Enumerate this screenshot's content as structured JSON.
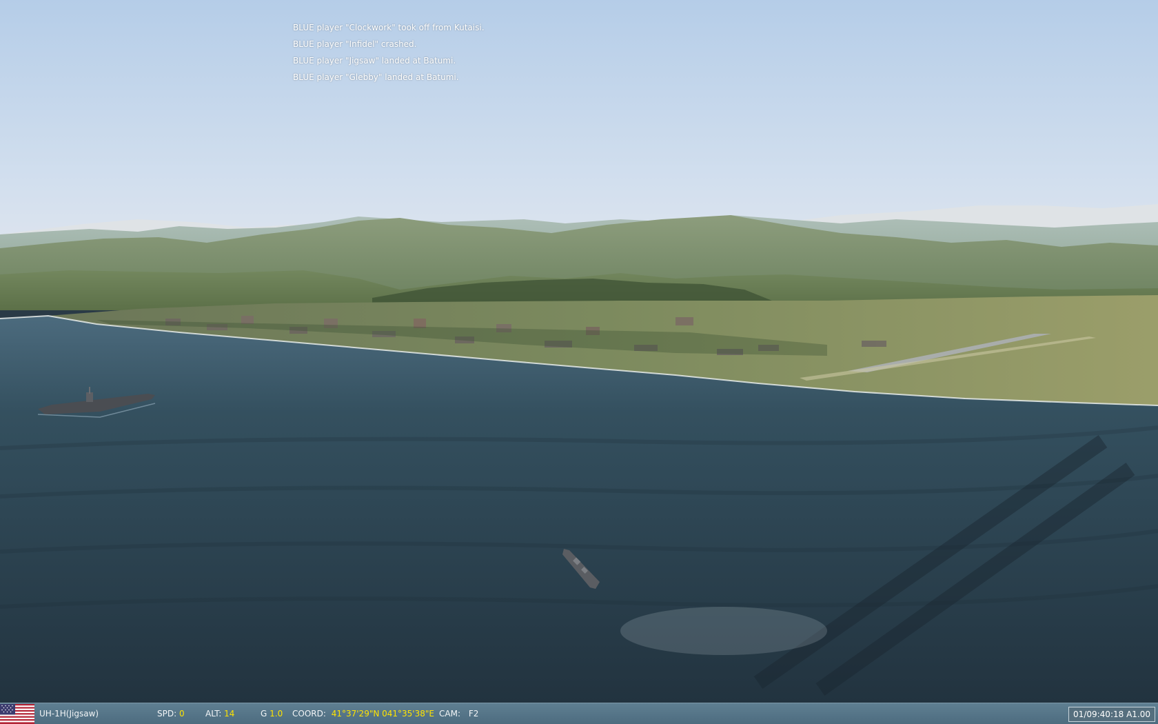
{
  "messages": [
    "BLUE player \"Clockwork\" took off from Kutaisi.",
    "BLUE player \"Infidel\" crashed.",
    "BLUE player \"Jigsaw\" landed at Batumi.",
    "BLUE player \"Glebby\" landed at Batumi."
  ],
  "status": {
    "unit": "UH-1H(Jigsaw)",
    "spd_label": "SPD:",
    "spd_value": "0",
    "alt_label": "ALT:",
    "alt_value": "14",
    "g_label": "G",
    "g_value": "1.0",
    "coord_label": "COORD:",
    "coord_value": "41°37'29\"N 041°35'38\"E",
    "cam_label": "CAM:",
    "cam_value": "F2",
    "clock": "01/09:40:18 A1.00"
  },
  "colors": {
    "hud_value": "#ffe400",
    "statusbar": "#5a7a8c",
    "sea": "#2e4655",
    "sky": "#c6d6ea"
  },
  "icons": {
    "faction_flag": "us-flag-icon"
  }
}
